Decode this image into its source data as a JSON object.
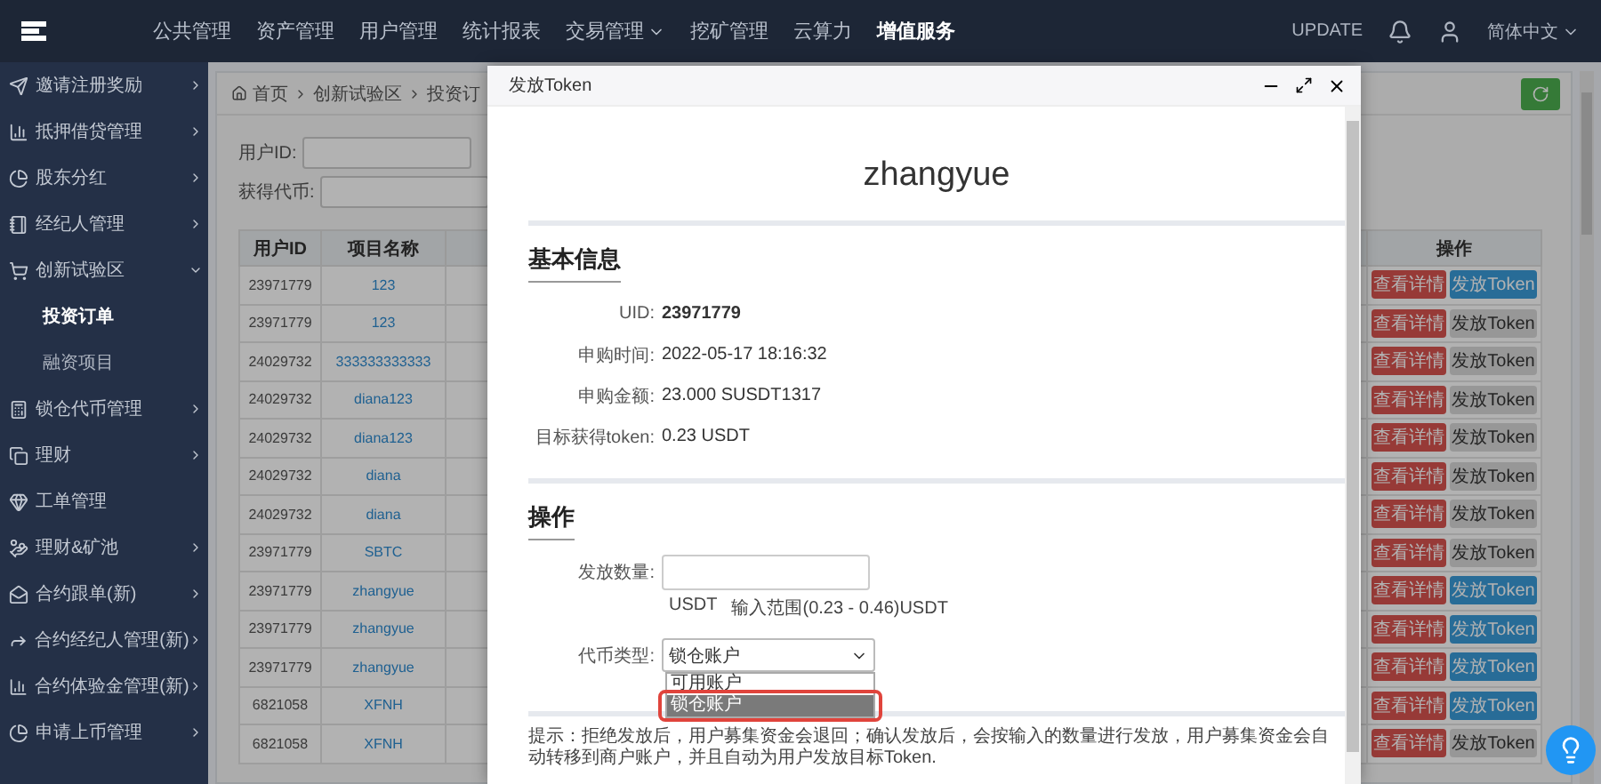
{
  "top_nav": {
    "menu_items": [
      {
        "label": "公共管理",
        "selected": false,
        "has_menu": false
      },
      {
        "label": "资产管理",
        "selected": false,
        "has_menu": false
      },
      {
        "label": "用户管理",
        "selected": false,
        "has_menu": false
      },
      {
        "label": "统计报表",
        "selected": false,
        "has_menu": false
      },
      {
        "label": "交易管理",
        "selected": false,
        "has_menu": true
      },
      {
        "label": "挖矿管理",
        "selected": false,
        "has_menu": false
      },
      {
        "label": "云算力",
        "selected": false,
        "has_menu": false
      },
      {
        "label": "增值服务",
        "selected": true,
        "has_menu": false
      }
    ],
    "update": "UPDATE",
    "language": "简体中文"
  },
  "sidebar": {
    "items": [
      {
        "label": "邀请注册奖励",
        "expanded": false
      },
      {
        "label": "抵押借贷管理",
        "expanded": false
      },
      {
        "label": "股东分红",
        "expanded": false
      },
      {
        "label": "经纪人管理",
        "expanded": false
      },
      {
        "label": "创新试验区",
        "expanded": true,
        "children": [
          {
            "label": "投资订单",
            "selected": true
          },
          {
            "label": "融资项目",
            "selected": false
          }
        ]
      },
      {
        "label": "锁仓代币管理",
        "expanded": false
      },
      {
        "label": "理财",
        "expanded": false
      },
      {
        "label": "工单管理"
      },
      {
        "label": "理财&矿池",
        "expanded": false
      },
      {
        "label": "合约跟单(新)",
        "expanded": false
      },
      {
        "label": "合约经纪人管理(新)",
        "expanded": false
      },
      {
        "label": "合约体验金管理(新)",
        "expanded": false
      },
      {
        "label": "申请上币管理",
        "expanded": false
      }
    ]
  },
  "breadcrumb": [
    "首页",
    "创新试验区",
    "投资订"
  ],
  "filters": [
    {
      "label": "用户ID:"
    },
    {
      "label": "获得代币:"
    }
  ],
  "table": {
    "columns": [
      "用户ID",
      "项目名称",
      "操作"
    ],
    "rows": [
      {
        "user_id": "23971779",
        "project": "123",
        "detail_button": "查看详情",
        "token_button": {
          "label": "发放Token",
          "disabled": false
        }
      },
      {
        "user_id": "23971779",
        "project": "123",
        "detail_button": "查看详情",
        "token_button": {
          "label": "发放Token",
          "disabled": true
        }
      },
      {
        "user_id": "24029732",
        "project": "333333333333",
        "detail_button": "查看详情",
        "token_button": {
          "label": "发放Token",
          "disabled": true
        }
      },
      {
        "user_id": "24029732",
        "project": "diana123",
        "detail_button": "查看详情",
        "token_button": {
          "label": "发放Token",
          "disabled": true
        }
      },
      {
        "user_id": "24029732",
        "project": "diana123",
        "detail_button": "查看详情",
        "token_button": {
          "label": "发放Token",
          "disabled": true
        }
      },
      {
        "user_id": "24029732",
        "project": "diana",
        "detail_button": "查看详情",
        "token_button": {
          "label": "发放Token",
          "disabled": true
        }
      },
      {
        "user_id": "24029732",
        "project": "diana",
        "detail_button": "查看详情",
        "token_button": {
          "label": "发放Token",
          "disabled": true
        }
      },
      {
        "user_id": "23971779",
        "project": "SBTC",
        "detail_button": "查看详情",
        "token_button": {
          "label": "发放Token",
          "disabled": true
        }
      },
      {
        "user_id": "23971779",
        "project": "zhangyue",
        "detail_button": "查看详情",
        "token_button": {
          "label": "发放Token",
          "disabled": false
        }
      },
      {
        "user_id": "23971779",
        "project": "zhangyue",
        "detail_button": "查看详情",
        "token_button": {
          "label": "发放Token",
          "disabled": false
        }
      },
      {
        "user_id": "23971779",
        "project": "zhangyue",
        "detail_button": "查看详情",
        "token_button": {
          "label": "发放Token",
          "disabled": false
        }
      },
      {
        "user_id": "6821058",
        "project": "XFNH",
        "detail_button": "查看详情",
        "token_button": {
          "label": "发放Token",
          "disabled": false
        }
      },
      {
        "user_id": "6821058",
        "project": "XFNH",
        "detail_button": "查看详情",
        "token_button": {
          "label": "发放Token",
          "disabled": true
        }
      }
    ]
  },
  "modal": {
    "title": "发放Token",
    "user_name": "zhangyue",
    "basic_info": {
      "heading": "基本信息",
      "fields": [
        {
          "label": "UID:",
          "value": "23971779",
          "bold": true
        },
        {
          "label": "申购时间:",
          "value": "2022-05-17 18:16:32",
          "bold": false
        },
        {
          "label": "申购金额:",
          "value": "23.000 SUSDT1317",
          "bold": false
        },
        {
          "label": "目标获得token:",
          "value": "0.23 USDT",
          "bold": false
        }
      ]
    },
    "operation": {
      "heading": "操作",
      "amount": {
        "label": "发放数量:",
        "unit": "USDT",
        "hint": "输入范围(0.23 - 0.46)USDT"
      },
      "token_type": {
        "label": "代币类型:",
        "value": "锁仓账户",
        "options": [
          {
            "label": "可用账户",
            "selected": false
          },
          {
            "label": "锁仓账户",
            "selected": true
          }
        ]
      }
    },
    "tip": "提示：拒绝发放后，用户募集资金会退回；确认发放后，会按输入的数量进行发放，用户募集资金会自动转移到商户账户，并且自动为用户发放目标Token."
  }
}
